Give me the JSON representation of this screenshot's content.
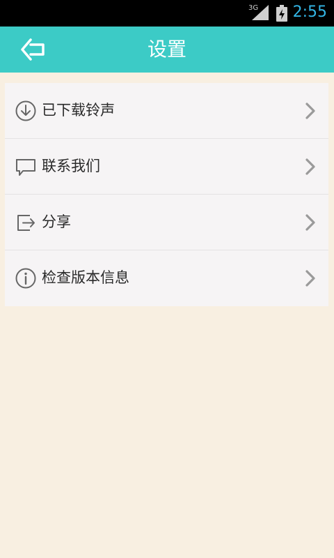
{
  "status_bar": {
    "network": "3G",
    "time": "2:55"
  },
  "header": {
    "title": "设置"
  },
  "menu": {
    "items": [
      {
        "label": "已下载铃声",
        "icon": "download-icon"
      },
      {
        "label": "联系我们",
        "icon": "chat-icon"
      },
      {
        "label": "分享",
        "icon": "share-icon"
      },
      {
        "label": "检查版本信息",
        "icon": "info-icon"
      }
    ]
  },
  "colors": {
    "header_bg": "#3ccbc6",
    "page_bg": "#f8efe1",
    "card_bg": "#f6f4f5",
    "clock": "#33b5e5"
  }
}
